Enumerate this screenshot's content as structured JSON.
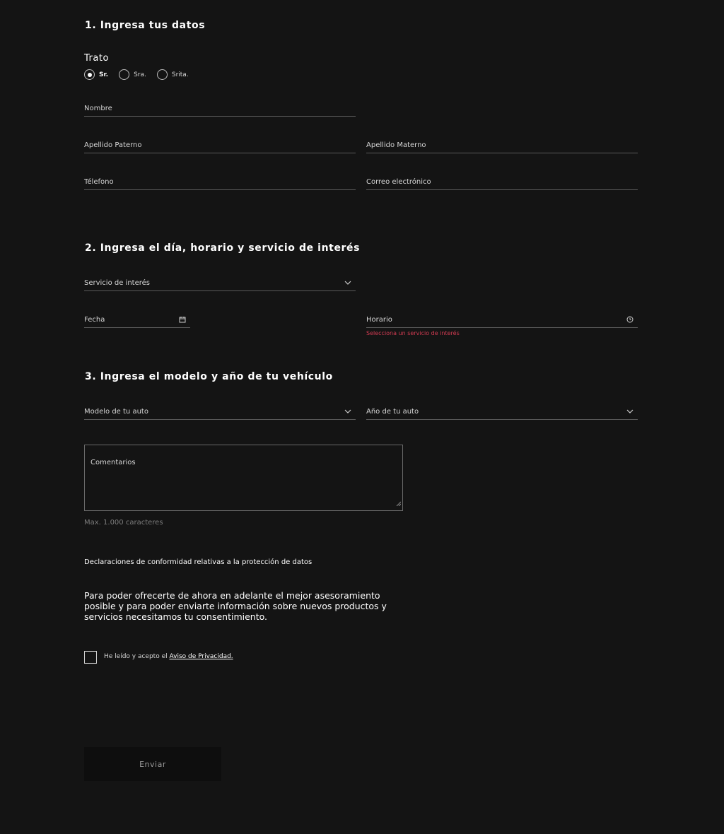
{
  "section1": {
    "title": "1. Ingresa tus datos",
    "trato_label": "Trato",
    "trato_options": [
      "Sr.",
      "Sra.",
      "Srita."
    ],
    "trato_selected": "Sr.",
    "nombre": "Nombre",
    "apellido_paterno": "Apellido Paterno",
    "apellido_materno": "Apellido Materno",
    "telefono": "Télefono",
    "correo": "Correo electrónico"
  },
  "section2": {
    "title": "2. Ingresa el día, horario y servicio de interés",
    "servicio": "Servicio de interés",
    "fecha": "Fecha",
    "horario": "Horario",
    "horario_error": "Selecciona un servicio de interés"
  },
  "section3": {
    "title": "3. Ingresa el modelo y año de tu vehículo",
    "modelo": "Modelo de tu auto",
    "anio": "Año de tu auto",
    "comentarios": "Comentarios",
    "comentarios_hint": "Max. 1.000 caracteres"
  },
  "consent": {
    "title": "Declaraciones de conformidad relativas a la protección de datos",
    "text": "Para poder ofrecerte de ahora en adelante el mejor asesoramiento posible y para poder enviarte información sobre nuevos productos y servicios necesitamos tu consentimiento.",
    "checkbox_text": "He leído y acepto el ",
    "privacy_link": "Aviso de Privacidad."
  },
  "submit_label": "Enviar",
  "icons": {
    "dropdown": "chevron-down-icon",
    "date": "calendar-icon",
    "time": "clock-icon"
  },
  "colors": {
    "background": "#141414",
    "error": "#d23b52",
    "button_bg": "#0e0e0e"
  }
}
